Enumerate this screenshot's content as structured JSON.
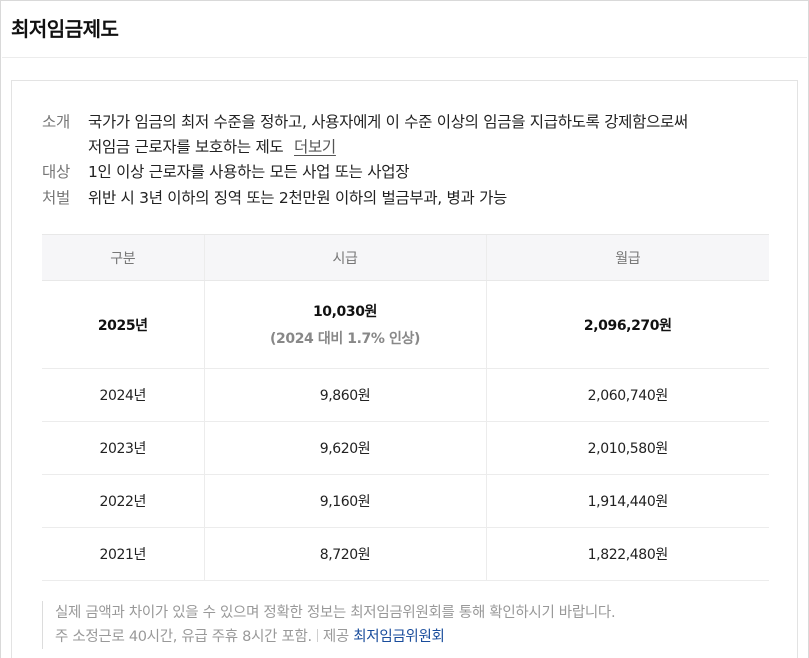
{
  "header": {
    "title": "최저임금제도"
  },
  "info": {
    "intro": {
      "label": "소개",
      "line1": "국가가 임금의 최저 수준을 정하고, 사용자에게 이 수준 이상의 임금을 지급하도록 강제함으로써",
      "line2": "저임금 근로자를 보호하는 제도",
      "more": "더보기"
    },
    "target": {
      "label": "대상",
      "text": "1인 이상 근로자를 사용하는 모든 사업 또는 사업장"
    },
    "penalty": {
      "label": "처벌",
      "text": "위반 시 3년 이하의 징역 또는 2천만원 이하의 벌금부과, 병과 가능"
    }
  },
  "table": {
    "headers": [
      "구분",
      "시급",
      "월급"
    ],
    "rows": [
      {
        "year": "2025년",
        "hourly": "10,030원",
        "note": "(2024 대비 1.7% 인상)",
        "monthly": "2,096,270원"
      },
      {
        "year": "2024년",
        "hourly": "9,860원",
        "monthly": "2,060,740원"
      },
      {
        "year": "2023년",
        "hourly": "9,620원",
        "monthly": "2,010,580원"
      },
      {
        "year": "2022년",
        "hourly": "9,160원",
        "monthly": "1,914,440원"
      },
      {
        "year": "2021년",
        "hourly": "8,720원",
        "monthly": "1,822,480원"
      }
    ]
  },
  "footer": {
    "note1": "실제 금액과 차이가 있을 수 있으며 정확한 정보는 최저임금위원회를 통해 확인하시기 바랍니다.",
    "note2": "주 소정근로 40시간, 유급 주휴 8시간 포함.",
    "source_label": "제공",
    "source_link": "최저임금위원회"
  },
  "colors": {
    "link": "#1a4d9c",
    "header_bg": "#f6f6f8",
    "muted_text": "#999999"
  }
}
